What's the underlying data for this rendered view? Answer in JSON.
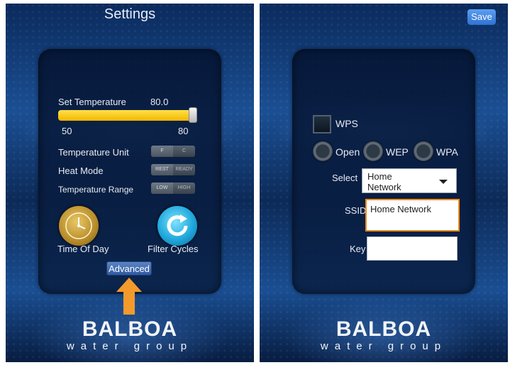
{
  "left_screen": {
    "title": "Settings",
    "set_temperature_label": "Set Temperature",
    "set_temperature_value": "80.0",
    "slider_min": "50",
    "slider_max": "80",
    "slider_fraction": 1.0,
    "temperature_unit_label": "Temperature Unit",
    "temperature_unit_options": [
      "F",
      "C"
    ],
    "heat_mode_label": "Heat Mode",
    "heat_mode_options": [
      "Rest",
      "Ready"
    ],
    "temperature_range_label": "Temperature Range",
    "temperature_range_options": [
      "Low",
      "High"
    ],
    "time_of_day_label": "Time Of Day",
    "filter_cycles_label": "Filter Cycles",
    "advanced_button": "Advanced",
    "arrow_color": "#f39a2c"
  },
  "right_screen": {
    "save_button": "Save",
    "wps_label": "WPS",
    "security_options": [
      "Open",
      "WEP",
      "WPA"
    ],
    "select_label": "Select",
    "select_value": "Home Network",
    "ssid_label": "SSID",
    "ssid_value": "Home Network",
    "key_label": "Key",
    "key_value": "",
    "highlight_color": "#f28c1a"
  },
  "brand": {
    "logo_main": "BALBOA",
    "logo_sub": "water group"
  }
}
